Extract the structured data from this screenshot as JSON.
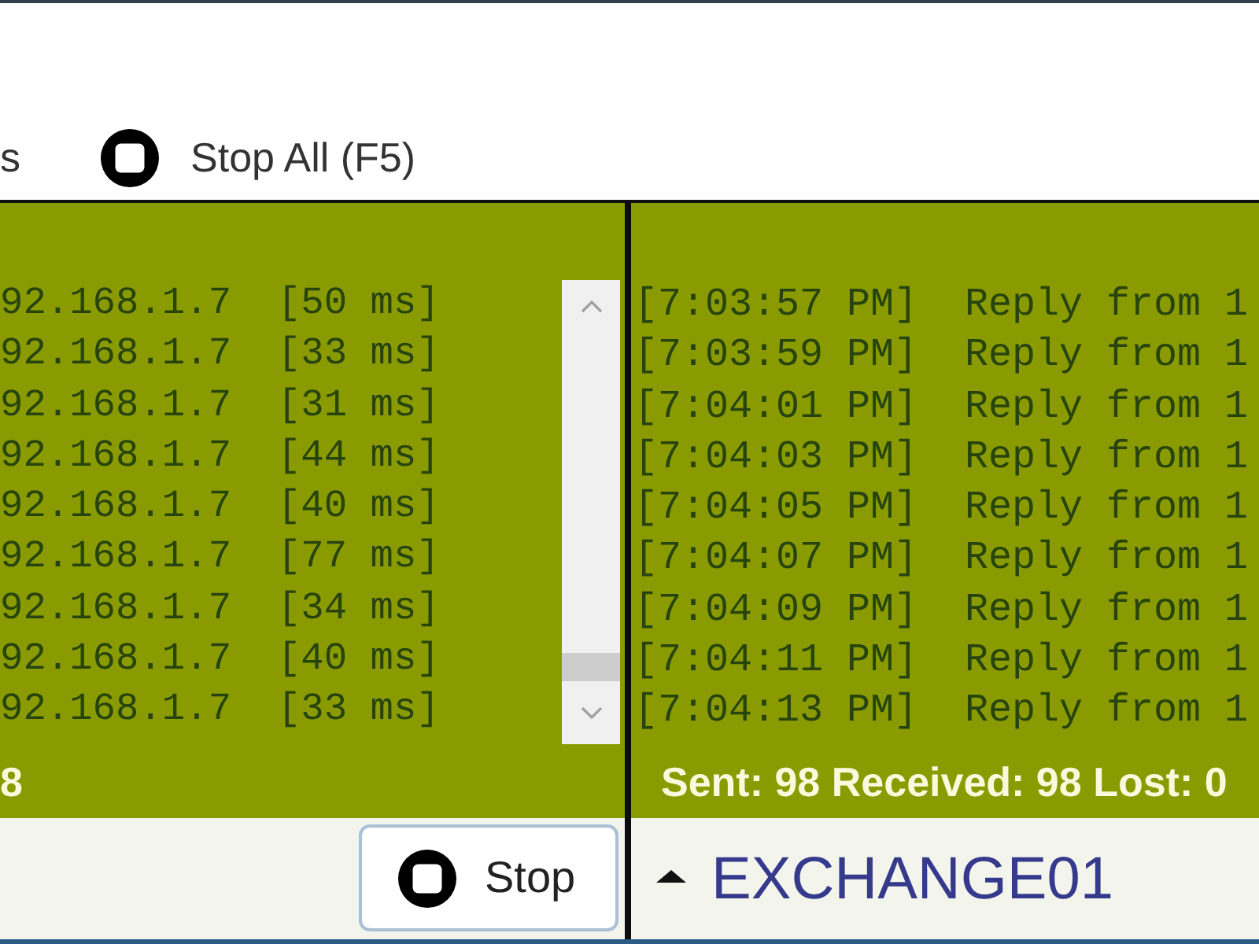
{
  "toolbar": {
    "partial_button_label": "s",
    "stop_all_button_label": "Stop All (F5)"
  },
  "panels": [
    {
      "lines": [
        "92.168.1.7  [50 ms]",
        "92.168.1.7  [33 ms]",
        "92.168.1.7  [31 ms]",
        "92.168.1.7  [44 ms]",
        "92.168.1.7  [40 ms]",
        "92.168.1.7  [77 ms]",
        "92.168.1.7  [34 ms]",
        "92.168.1.7  [40 ms]",
        "92.168.1.7  [33 ms]"
      ],
      "scrollbar": true,
      "summary": "8",
      "footer": {
        "kind": "stop_button",
        "label": "Stop"
      }
    },
    {
      "lines": [
        "[7:03:57 PM]  Reply from 1",
        "[7:03:59 PM]  Reply from 1",
        "[7:04:01 PM]  Reply from 1",
        "[7:04:03 PM]  Reply from 1",
        "[7:04:05 PM]  Reply from 1",
        "[7:04:07 PM]  Reply from 1",
        "[7:04:09 PM]  Reply from 1",
        "[7:04:11 PM]  Reply from 1",
        "[7:04:13 PM]  Reply from 1"
      ],
      "scrollbar": false,
      "summary": "Sent: 98 Received: 98 Lost: 0",
      "footer": {
        "kind": "host_header",
        "label": "EXCHANGE01"
      }
    }
  ]
}
